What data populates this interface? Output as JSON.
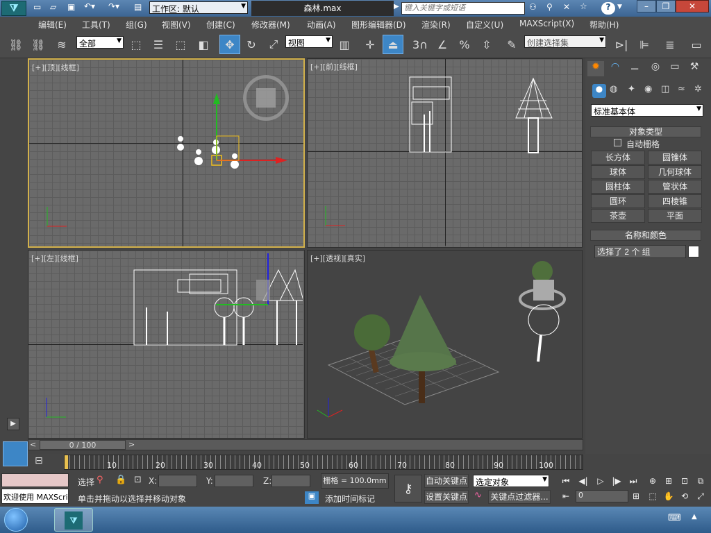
{
  "title_bar": {
    "workspace_label": "工作区: 默认",
    "filename": "森林.max",
    "search_placeholder": "键入关键字或短语",
    "help_label": "?"
  },
  "menu": [
    "编辑(E)",
    "工具(T)",
    "组(G)",
    "视图(V)",
    "创建(C)",
    "修改器(M)",
    "动画(A)",
    "图形编辑器(D)",
    "渲染(R)",
    "自定义(U)",
    "MAXScript(X)",
    "帮助(H)"
  ],
  "toolbar": {
    "selection_filter": "全部",
    "reference_coord": "视图",
    "snap_3": "3",
    "named_selection": "创建选择集"
  },
  "viewports": {
    "top": {
      "label": "[+][顶][线框]"
    },
    "front": {
      "label": "[+][前][线框]"
    },
    "left": {
      "label": "[+][左][线框]"
    },
    "perspective": {
      "label": "[+][透视][真实]"
    }
  },
  "command_panel": {
    "category": "标准基本体",
    "object_type_title": "对象类型",
    "auto_grid": "自动栅格",
    "buttons": [
      "长方体",
      "圆锥体",
      "球体",
      "几何球体",
      "圆柱体",
      "管状体",
      "圆环",
      "四棱锥",
      "茶壶",
      "平面"
    ],
    "name_color_title": "名称和颜色",
    "name_value": "选择了 2 个 组"
  },
  "timeline": {
    "frame_label": "0 / 100",
    "ticks": [
      "10",
      "20",
      "30",
      "40",
      "50",
      "60",
      "70",
      "80",
      "90",
      "100"
    ]
  },
  "status": {
    "maxscript_listener": "欢迎使用 MAXScri",
    "selection_label": "选择",
    "x_label": "X:",
    "y_label": "Y:",
    "z_label": "Z:",
    "grid": "栅格 = 100.0mm",
    "prompt": "单击并拖动以选择并移动对象",
    "add_time_tag": "添加时间标记",
    "auto_key": "自动关键点",
    "set_key": "设置关键点",
    "key_mode": "选定对象",
    "key_filters": "关键点过滤器...",
    "current_frame": "0"
  },
  "colors": {
    "active_blue": "#3d86c6",
    "viewport_border_active": "#d2b14b"
  }
}
